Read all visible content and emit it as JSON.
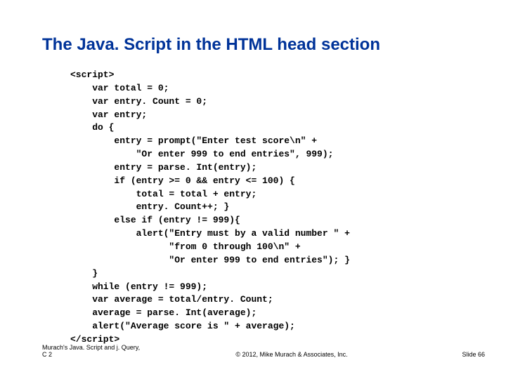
{
  "title": "The Java. Script in the HTML head section",
  "code": "<script>\n    var total = 0;\n    var entry. Count = 0;\n    var entry;\n    do {\n        entry = prompt(\"Enter test score\\n\" +\n            \"Or enter 999 to end entries\", 999);\n        entry = parse. Int(entry);\n        if (entry >= 0 && entry <= 100) {\n            total = total + entry;\n            entry. Count++; }\n        else if (entry != 999){\n            alert(\"Entry must by a valid number \" +\n                  \"from 0 through 100\\n\" +\n                  \"Or enter 999 to end entries\"); }\n    }\n    while (entry != 999);\n    var average = total/entry. Count;\n    average = parse. Int(average);\n    alert(\"Average score is \" + average);\n</script>",
  "footer": {
    "left": "Murach's Java. Script and j. Query, C 2",
    "center": "© 2012, Mike Murach & Associates, Inc.",
    "right": "Slide 66"
  }
}
